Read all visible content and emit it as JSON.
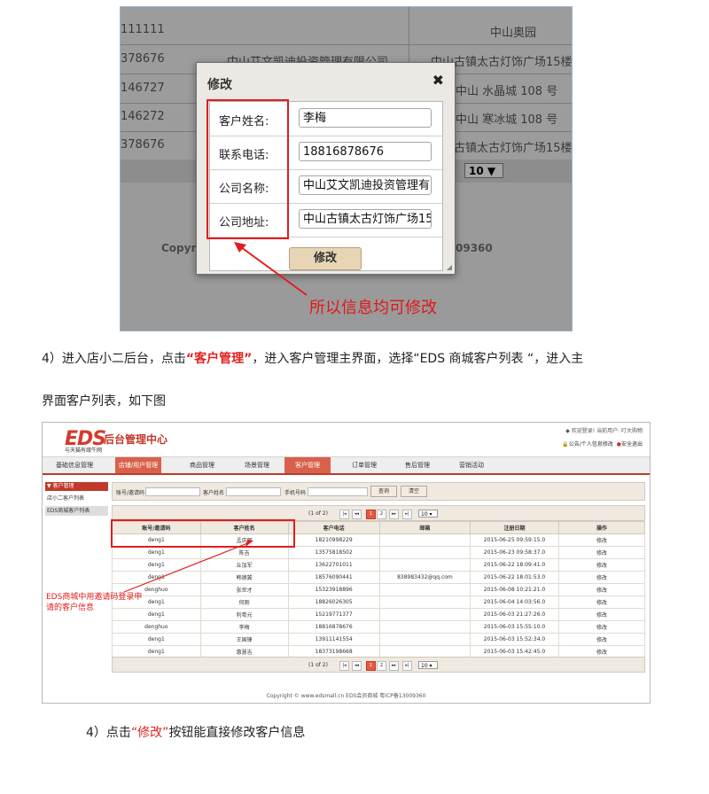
{
  "screenshot1": {
    "background_rows": [
      {
        "left": "111111",
        "right": "中山奥园"
      },
      {
        "left": "378676",
        "mid": "中山艾文凯迪投资管理有限公司",
        "right": "中山古镇太古灯饰广场15楼"
      },
      {
        "left": "146727",
        "right": "中山 水晶城 108 号"
      },
      {
        "left": "146272",
        "right": "中山 寒冰城 108 号"
      },
      {
        "left": "378676",
        "right": "中山古镇太古灯饰广场15楼"
      }
    ],
    "pager_value": "10 ▼",
    "copyright_left": "Copyr",
    "copyright_right": "09360",
    "modal": {
      "title": "修改",
      "close": "✖",
      "fields": [
        {
          "label": "客户姓名:",
          "value": "李梅"
        },
        {
          "label": "联系电话:",
          "value": "18816878676"
        },
        {
          "label": "公司名称:",
          "value": "中山艾文凯迪投资管理有"
        },
        {
          "label": "公司地址:",
          "value": "中山古镇太古灯饰广场15"
        }
      ],
      "submit": "修改"
    },
    "annotation": "所以信息均可修改"
  },
  "instruction": {
    "prefix": "4）进入店小二后台，点击",
    "highlight": "“客户管理”",
    "suffix": "，进入客户管理主界面，选择“EDS 商城客户列表 “，进入主",
    "line2": "界面客户列表，如下图"
  },
  "screenshot2": {
    "logo": "EDS",
    "logo_sub": "与天猫有缘牛网",
    "app_title": "后台管理中心",
    "welcome": "◆ 欢迎登录! 当前用户: 叮大购物",
    "link_notice": "公告/个人信息修改",
    "link_logout": "安全退出",
    "nav": [
      "基础信息管理",
      "店铺/用户管理",
      "商品管理",
      "场景管理",
      "客户管理",
      "订单管理",
      "售后管理",
      "营销活动"
    ],
    "sidebar": {
      "header": "▼ 客户管理",
      "items": [
        "店小二客户列表",
        "EDS商城客户列表"
      ]
    },
    "search": {
      "account_label": "账号/邀请码",
      "name_label": "客户姓名",
      "phone_label": "手机号码",
      "query": "查询",
      "clear": "清空"
    },
    "pager": {
      "text": "(1 of 2)",
      "first": "|◂",
      "prev": "◂◂",
      "p1": "1",
      "p2": "2",
      "next": "▸▸",
      "last": "▸|",
      "size": "10 ▾"
    },
    "columns": [
      "账号/邀请码",
      "客户姓名",
      "客户电话",
      "邮箱",
      "注册日期",
      "操作"
    ],
    "rows": [
      [
        "deng1",
        "孟庆辉",
        "18210998229",
        "",
        "2015-06-25 09:59:15.0",
        "修改"
      ],
      [
        "deng1",
        "陈吉",
        "13575818502",
        "",
        "2015-06-23 09:58:37.0",
        "修改"
      ],
      [
        "deng1",
        "丘加军",
        "13622701011",
        "",
        "2015-06-22 18:09:41.0",
        "修改"
      ],
      [
        "deng1",
        "韩德冀",
        "18576090441",
        "838983432@qq.com",
        "2015-06-22 18:01:53.0",
        "修改"
      ],
      [
        "denghuo",
        "张世才",
        "15323918896",
        "",
        "2015-06-08 10:21:21.0",
        "修改"
      ],
      [
        "deng1",
        "何刚",
        "18826026305",
        "",
        "2015-06-04 14:03:56.0",
        "修改"
      ],
      [
        "deng1",
        "利粤元",
        "15219771377",
        "",
        "2015-06-03 21:27:26.0",
        "修改"
      ],
      [
        "denghuo",
        "李梅",
        "18816878676",
        "",
        "2015-06-03 15:55:10.0",
        "修改"
      ],
      [
        "deng1",
        "王国锋",
        "13911141554",
        "",
        "2015-06-03 15:52:34.0",
        "修改"
      ],
      [
        "deng1",
        "惠慧吉",
        "18373198668",
        "",
        "2015-06-03 15:42:45.0",
        "修改"
      ]
    ],
    "copyright": "Copyright © www.edsmall.cn EDS会员商城 粤ICP备13009360",
    "annotation": "EDS商城中用邀请码登录申请的客户信息"
  },
  "step4": {
    "prefix": "4）点击",
    "highlight": "“修改”",
    "suffix": "按钮能直接修改客户信息"
  }
}
